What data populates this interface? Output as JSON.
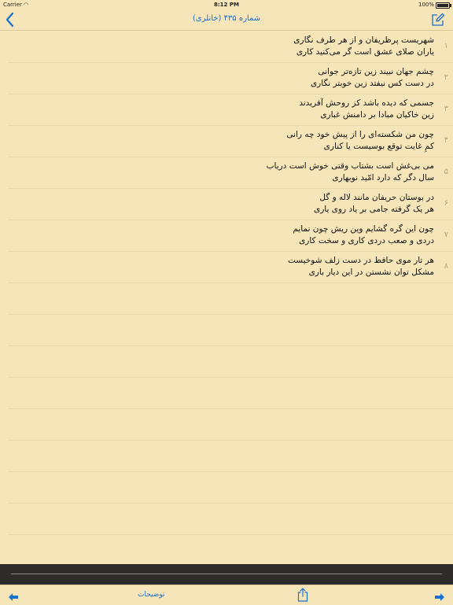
{
  "status_bar": {
    "carrier": "Carrier",
    "time": "8:12 PM",
    "battery": "100%"
  },
  "nav": {
    "title": "شماره ۴۳۵ (خانلری)",
    "back_icon": "chevron-left-icon",
    "compose_icon": "compose-icon"
  },
  "poem": {
    "rows": [
      {
        "number": "۱",
        "line1": "شهریست پرظریفان و از هر طرف نگاری",
        "line2": "یاران صلای عشق است گر می‌کنید کاری"
      },
      {
        "number": "۲",
        "line1": "چشم جهان نبیند زین تازه‌تر جوانی",
        "line2": "در دست کس نیفتد زین خوبتر نگاری"
      },
      {
        "number": "۳",
        "line1": "جسمی که دیده باشد کز روحش آفریدند",
        "line2": "زین خاکیان مبادا بر دامنش غباری"
      },
      {
        "number": "۴",
        "line1": "چون من شکسته‌ای را از پیش خود چه رانی",
        "line2": "کمِ غایت توقع بوسیست یا کناری"
      },
      {
        "number": "۵",
        "line1": "می بی‌غش است بشتاب وقتی خوش است دریاب",
        "line2": "سال دگر که دارد امّید نوبهاری"
      },
      {
        "number": "۶",
        "line1": "در بوستان حریفان مانند لاله و گل",
        "line2": "هر یک گرفته جامی بر یاد روی یاری"
      },
      {
        "number": "۷",
        "line1": "چون این گره گشایم وین ریش چون نمایم",
        "line2": "دردی و صعب دردی کاری و سخت کاری"
      },
      {
        "number": "۸",
        "line1": "هر تار موی حافظ در دست زلف شوخیست",
        "line2": "مشکل توان نشستن در این دیار باری"
      },
      {
        "number": "",
        "line1": "",
        "line2": ""
      },
      {
        "number": "",
        "line1": "",
        "line2": ""
      },
      {
        "number": "",
        "line1": "",
        "line2": ""
      },
      {
        "number": "",
        "line1": "",
        "line2": ""
      },
      {
        "number": "",
        "line1": "",
        "line2": ""
      },
      {
        "number": "",
        "line1": "",
        "line2": ""
      },
      {
        "number": "",
        "line1": "",
        "line2": ""
      },
      {
        "number": "",
        "line1": "",
        "line2": ""
      },
      {
        "number": "",
        "line1": "",
        "line2": ""
      }
    ]
  },
  "toolbar": {
    "notes_label": "توضیحات",
    "prev_icon": "arrow-left-icon",
    "next_icon": "arrow-right-icon",
    "share_icon": "share-icon"
  },
  "colors": {
    "background": "#f6e5b8",
    "accent": "#1a6fd1",
    "dark_bar": "#2e2c2a"
  }
}
